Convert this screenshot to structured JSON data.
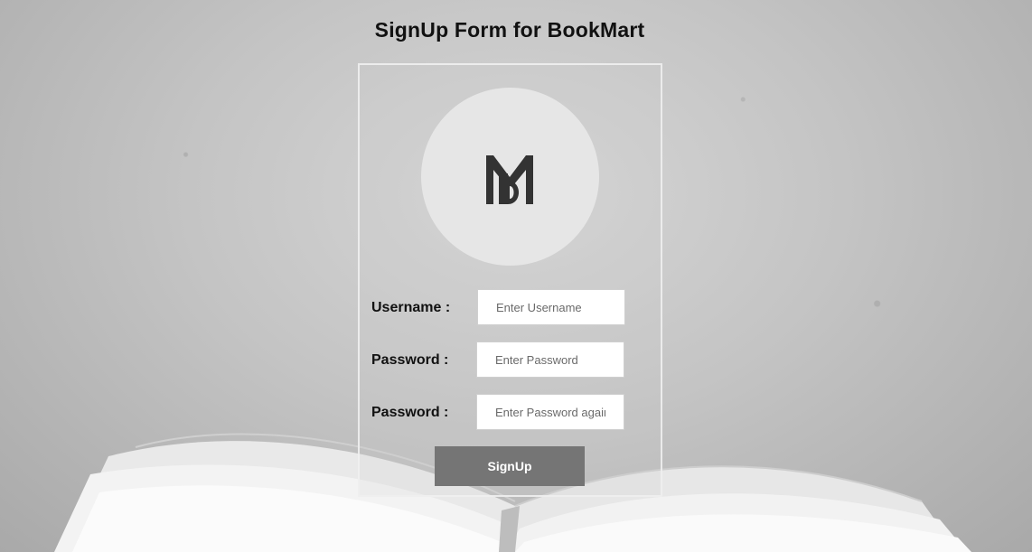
{
  "page": {
    "title": "SignUp Form for BookMart"
  },
  "logo": {
    "icon": "bookmart-logo-icon",
    "letters": "MB"
  },
  "form": {
    "fields": [
      {
        "label": "Username :",
        "placeholder": "Enter Username",
        "value": ""
      },
      {
        "label": "Password :",
        "placeholder": "Enter Password",
        "value": ""
      },
      {
        "label": "Password :",
        "placeholder": "Enter Password again",
        "value": ""
      }
    ],
    "submit_label": "SignUp"
  },
  "colors": {
    "button_bg": "#757575",
    "logo_circle": "#e6e6e6",
    "logo_mark": "#333333"
  }
}
